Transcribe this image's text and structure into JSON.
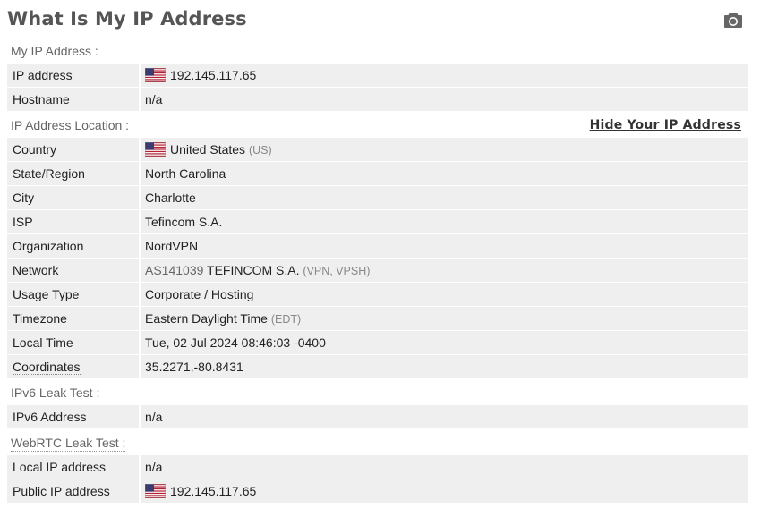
{
  "page_title": "What Is My IP Address",
  "icons": {
    "camera": "camera-icon",
    "flag": "us-flag-icon"
  },
  "sections": {
    "my_ip": "My IP Address :",
    "location": "IP Address Location :",
    "ipv6": "IPv6 Leak Test :",
    "webrtc": "WebRTC Leak Test :"
  },
  "hide_link": "Hide Your IP Address",
  "my_ip": {
    "ip_label": "IP address",
    "ip_value": "192.145.117.65",
    "hostname_label": "Hostname",
    "hostname_value": "n/a"
  },
  "location": {
    "country_label": "Country",
    "country_value": "United States",
    "country_code": "(US)",
    "state_label": "State/Region",
    "state_value": "North Carolina",
    "city_label": "City",
    "city_value": "Charlotte",
    "isp_label": "ISP",
    "isp_value": "Tefincom S.A.",
    "org_label": "Organization",
    "org_value": "NordVPN",
    "network_label": "Network",
    "network_asn": "AS141039",
    "network_name": "TEFINCOM S.A.",
    "network_tags": "(VPN, VPSH)",
    "usage_label": "Usage Type",
    "usage_value": "Corporate / Hosting",
    "timezone_label": "Timezone",
    "timezone_value": "Eastern Daylight Time",
    "timezone_abbr": "(EDT)",
    "localtime_label": "Local Time",
    "localtime_value": "Tue, 02 Jul 2024 08:46:03 -0400",
    "coords_label": "Coordinates",
    "coords_value": "35.2271,-80.8431"
  },
  "ipv6": {
    "label": "IPv6 Address",
    "value": "n/a"
  },
  "webrtc": {
    "local_label": "Local IP address",
    "local_value": "n/a",
    "public_label": "Public IP address",
    "public_value": "192.145.117.65"
  }
}
